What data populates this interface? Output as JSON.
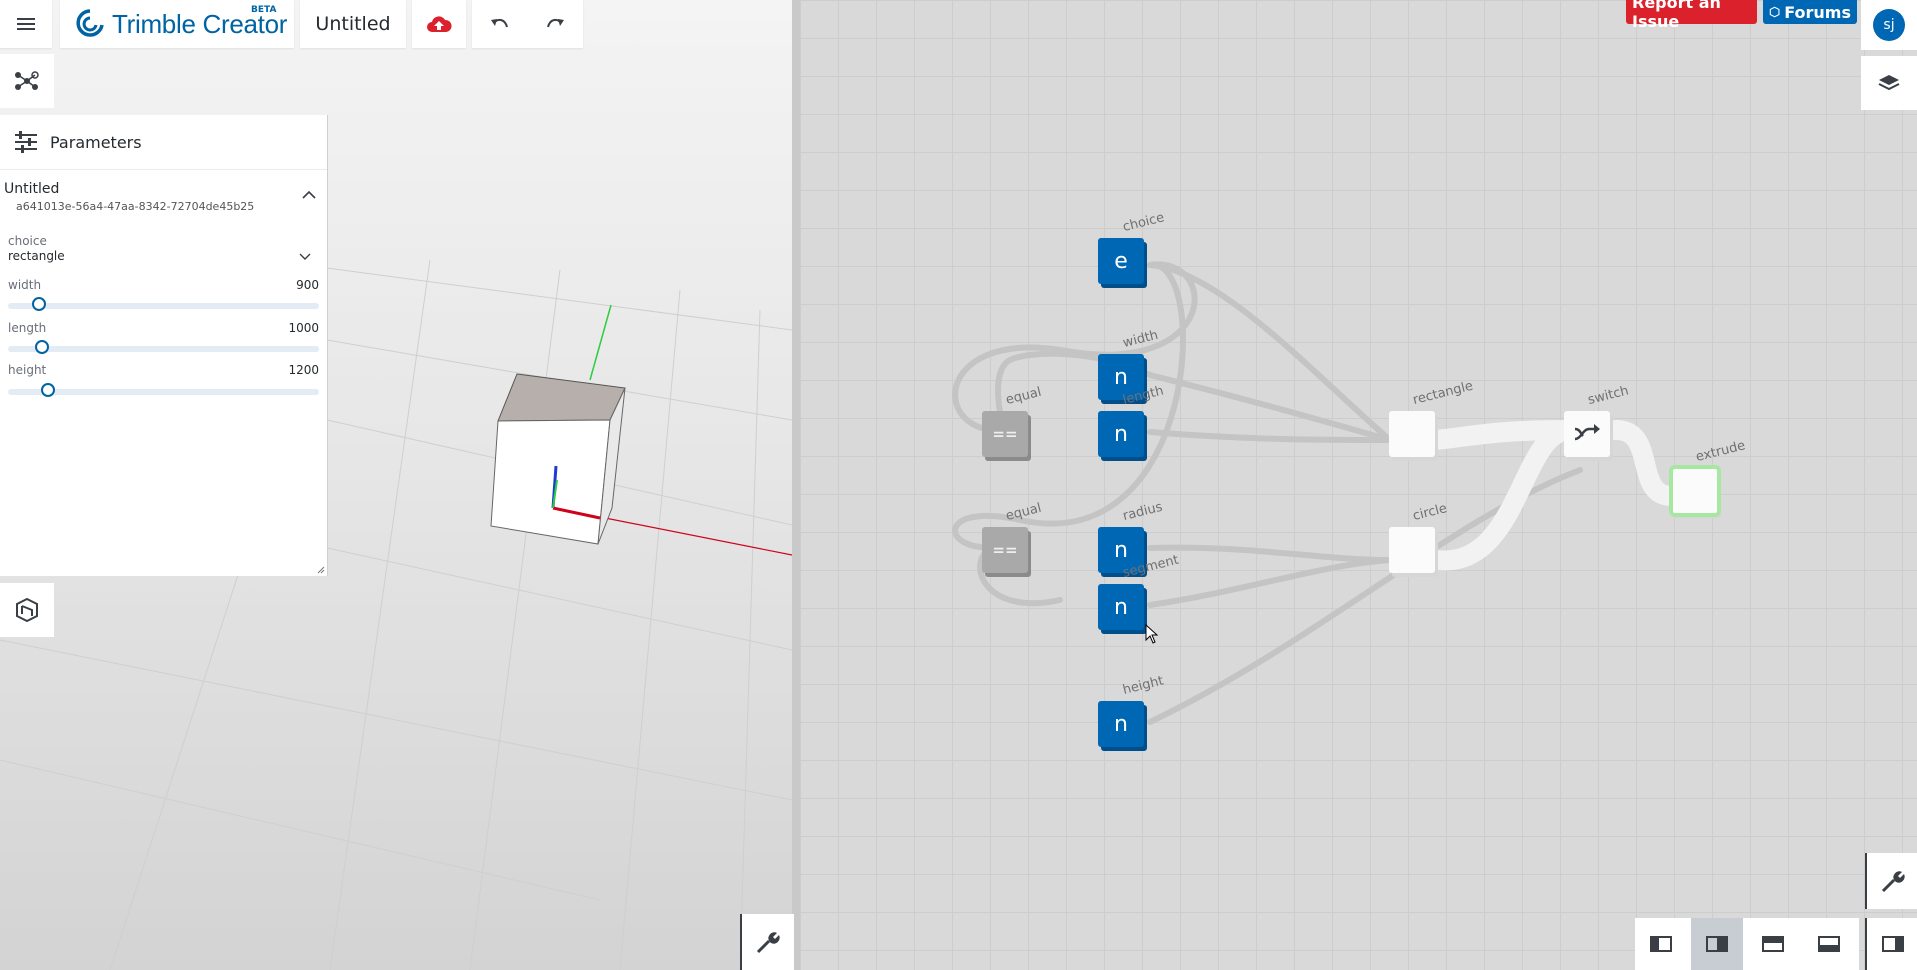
{
  "app": {
    "name": "Trimble Creator",
    "badge": "BETA",
    "doc_title": "Untitled"
  },
  "colors": {
    "brand": "#0063a3",
    "node_blue": "#0067b5",
    "report": "#da212c",
    "save_icon": "#da212c",
    "axis_x": "#d0021b",
    "axis_y": "#2ecc40",
    "axis_z": "#1f3bd6"
  },
  "icons": {
    "menu": "hamburger-menu-icon",
    "save": "cloud-upload-icon",
    "undo": "undo-icon",
    "redo": "redo-icon",
    "graph": "node-graph-icon",
    "params": "sliders-icon",
    "sketchup": "sketchup-logo-icon",
    "layers": "layers-icon",
    "tools": "wrench-icon",
    "switch": "shuffle-icon"
  },
  "parameters": {
    "header": "Parameters",
    "doc_name": "Untitled",
    "doc_id": "a641013e-56a4-47aa-8342-72704de45b25",
    "choice": {
      "label": "choice",
      "value": "rectangle"
    },
    "width": {
      "label": "width",
      "value": "900",
      "fraction": 0.08
    },
    "length": {
      "label": "length",
      "value": "1000",
      "fraction": 0.09
    },
    "height": {
      "label": "height",
      "value": "1200",
      "fraction": 0.11
    }
  },
  "topright": {
    "report": "Report an Issue",
    "forums": "Forums",
    "avatar": "sj"
  },
  "nodes": {
    "choice": {
      "label": "choice",
      "glyph": "e"
    },
    "width": {
      "label": "width",
      "glyph": "n"
    },
    "length": {
      "label": "length",
      "glyph": "n"
    },
    "radius": {
      "label": "radius",
      "glyph": "n"
    },
    "segment": {
      "label": "segment",
      "glyph": "n"
    },
    "height": {
      "label": "height",
      "glyph": "n"
    },
    "equal1": {
      "label": "equal",
      "glyph": "=="
    },
    "equal2": {
      "label": "equal",
      "glyph": "=="
    },
    "rectangle": {
      "label": "rectangle"
    },
    "circle": {
      "label": "circle"
    },
    "switch": {
      "label": "switch"
    },
    "extrude": {
      "label": "extrude"
    }
  }
}
